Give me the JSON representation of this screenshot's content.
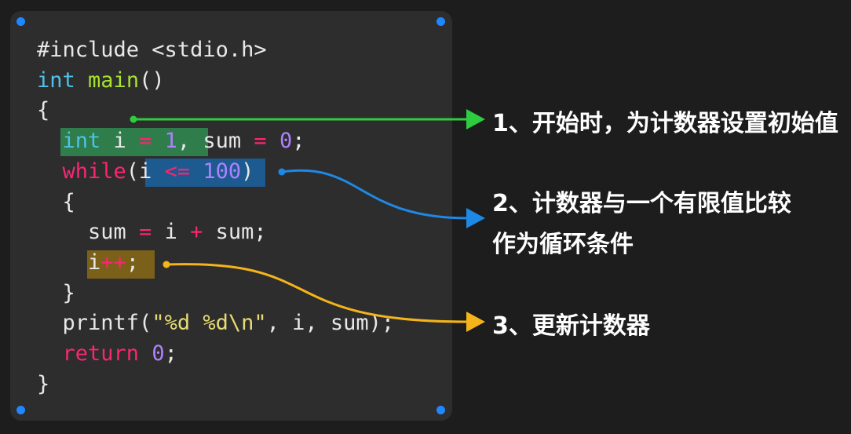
{
  "code_lines": [
    [
      {
        "t": "#include <stdio.h>",
        "c": "#e8e8e8"
      }
    ],
    [
      {
        "t": "int",
        "c": "#4fc1e9"
      },
      {
        "t": " ",
        "c": "#e8e8e8"
      },
      {
        "t": "main",
        "c": "#a6e22e"
      },
      {
        "t": "()",
        "c": "#e8e8e8"
      }
    ],
    [
      {
        "t": "{",
        "c": "#e8e8e8"
      }
    ],
    [
      {
        "t": "  ",
        "c": "#e8e8e8"
      },
      {
        "t": "int",
        "c": "#4fc1e9"
      },
      {
        "t": " i ",
        "c": "#e8e8e8"
      },
      {
        "t": "=",
        "c": "#f92672"
      },
      {
        "t": " ",
        "c": "#e8e8e8"
      },
      {
        "t": "1",
        "c": "#ae81ff"
      },
      {
        "t": ", sum ",
        "c": "#e8e8e8"
      },
      {
        "t": "=",
        "c": "#f92672"
      },
      {
        "t": " ",
        "c": "#e8e8e8"
      },
      {
        "t": "0",
        "c": "#ae81ff"
      },
      {
        "t": ";",
        "c": "#e8e8e8"
      }
    ],
    [
      {
        "t": "  ",
        "c": "#e8e8e8"
      },
      {
        "t": "while",
        "c": "#f92672"
      },
      {
        "t": "(i ",
        "c": "#e8e8e8"
      },
      {
        "t": "<=",
        "c": "#f92672"
      },
      {
        "t": " ",
        "c": "#e8e8e8"
      },
      {
        "t": "100",
        "c": "#ae81ff"
      },
      {
        "t": ")",
        "c": "#e8e8e8"
      }
    ],
    [
      {
        "t": "  {",
        "c": "#e8e8e8"
      }
    ],
    [
      {
        "t": "    sum ",
        "c": "#e8e8e8"
      },
      {
        "t": "=",
        "c": "#f92672"
      },
      {
        "t": " i ",
        "c": "#e8e8e8"
      },
      {
        "t": "+",
        "c": "#f92672"
      },
      {
        "t": " sum;",
        "c": "#e8e8e8"
      }
    ],
    [
      {
        "t": "    i",
        "c": "#e8e8e8"
      },
      {
        "t": "++",
        "c": "#f92672"
      },
      {
        "t": ";",
        "c": "#e8e8e8"
      }
    ],
    [
      {
        "t": "  }",
        "c": "#e8e8e8"
      }
    ],
    [
      {
        "t": "  printf(",
        "c": "#e8e8e8"
      },
      {
        "t": "\"%d %d\\n\"",
        "c": "#e6db74"
      },
      {
        "t": ", i, sum);",
        "c": "#e8e8e8"
      }
    ],
    [
      {
        "t": "  ",
        "c": "#e8e8e8"
      },
      {
        "t": "return",
        "c": "#f92672"
      },
      {
        "t": " ",
        "c": "#e8e8e8"
      },
      {
        "t": "0",
        "c": "#ae81ff"
      },
      {
        "t": ";",
        "c": "#e8e8e8"
      }
    ],
    [
      {
        "t": "}",
        "c": "#e8e8e8"
      }
    ]
  ],
  "annotations": {
    "init": "1、开始时，为计数器设置初始值",
    "compare_line1": "2、计数器与一个有限值比较",
    "compare_line2": "作为循环条件",
    "update": "3、更新计数器"
  },
  "colors": {
    "background": "#1d1d1d",
    "code_panel": "#2d2d2d",
    "corner_dot": "#1e88ff",
    "arrow_green": "#2ecc40",
    "arrow_blue": "#1e88e5",
    "arrow_gold": "#f4b41a",
    "highlight_green": "#2e7d4a",
    "highlight_blue": "#1d5a8f",
    "highlight_gold": "#7b6019"
  }
}
